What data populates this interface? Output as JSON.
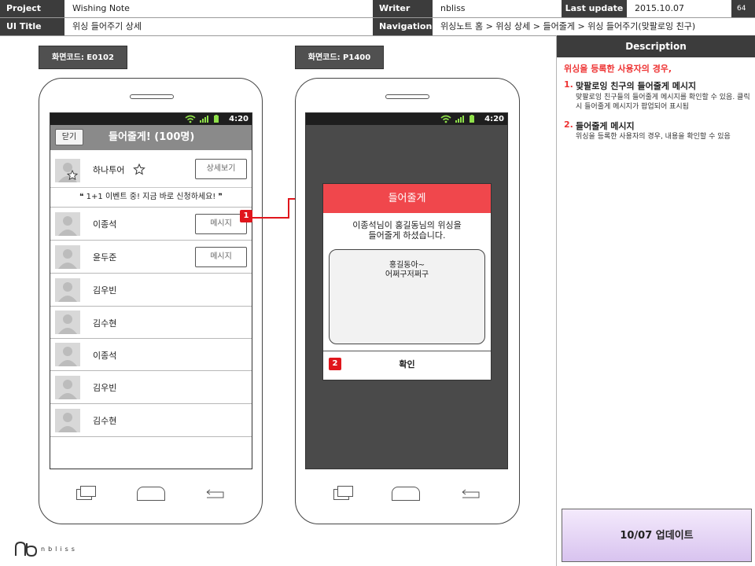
{
  "header": {
    "project_label": "Project",
    "project_value": "Wishing Note",
    "writer_label": "Writer",
    "writer_value": "nbliss",
    "last_update_label": "Last update",
    "last_update_value": "2015.10.07",
    "page_number": "64",
    "ui_title_label": "UI Title",
    "ui_title_value": "위싱 들어주기 상세",
    "navigation_label": "Navigation",
    "navigation_value": "위싱노트 홈 > 위싱 상세 > 들어줄게 > 위싱 들어주기(맞팔로잉 친구)"
  },
  "screen_left": {
    "code": "화면코드: E0102",
    "time": "4:20",
    "close_label": "닫기",
    "title": "들어줄게! (100명)",
    "featured": {
      "name": "하나투어",
      "detail_button": "상세보기",
      "message": "❝ 1+1 이벤트 중! 지금 바로 신청하세요! ❞"
    },
    "rows": [
      {
        "name": "이종석",
        "button": "메시지"
      },
      {
        "name": "윤두준",
        "button": "메시지"
      },
      {
        "name": "김우빈"
      },
      {
        "name": "김수현"
      },
      {
        "name": "이종석"
      },
      {
        "name": "김우빈"
      },
      {
        "name": "김수현"
      }
    ]
  },
  "screen_right": {
    "code": "화면코드: P1400",
    "time": "4:20",
    "dialog_title": "들어줄게",
    "message_line1": "이종석님이 홍길동님의 위싱을",
    "message_line2": "들어줄게 하셨습니다.",
    "note_line1": "홍길동아~",
    "note_line2": "어쩌구저쩌구",
    "confirm_label": "확인"
  },
  "badges": {
    "badge1": "1",
    "badge2": "2"
  },
  "description": {
    "heading": "Description",
    "intro": "위싱을 등록한 사용자의 경우,",
    "items": [
      {
        "number": "1.",
        "title": "맞팔로잉 친구의 들어줄게 메시지",
        "body": "맞팔로잉 친구들의 들어줄게 메시지를 확인할 수 있음. 클릭 시 들어줄게 메시지가 팝업되어 표시됨"
      },
      {
        "number": "2.",
        "title": "들어줄게 메시지",
        "body": "위싱을 등록한 사용자의 경우, 내용을 확인할 수 있음"
      }
    ]
  },
  "update_note": "10/07 업데이트",
  "logo_text": "nbliss",
  "colors": {
    "accent_red": "#f0474c",
    "badge_red": "#e0161c",
    "header_dark": "#3c3c3c",
    "intro_red": "#e33333",
    "update_purple": "#d8c3ef"
  }
}
